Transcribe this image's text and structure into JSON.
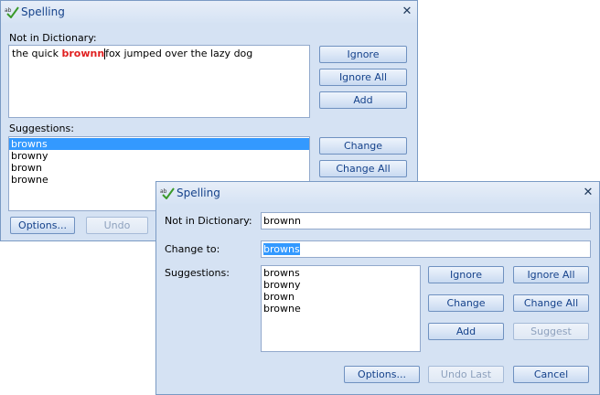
{
  "back_dialog": {
    "title": "Spelling",
    "close_symbol": "✕",
    "not_in_dict_label": "Not in Dictionary:",
    "sentence_before": "the quick ",
    "sentence_error": "brownn",
    "sentence_after": "fox jumped over the lazy dog",
    "suggestions_label": "Suggestions:",
    "suggestions": [
      "browns",
      "browny",
      "brown",
      "browne"
    ],
    "selected_suggestion": "browns",
    "buttons": {
      "ignore": "Ignore",
      "ignore_all": "Ignore All",
      "add": "Add",
      "change": "Change",
      "change_all": "Change All",
      "options": "Options...",
      "undo": "Undo"
    }
  },
  "front_dialog": {
    "title": "Spelling",
    "close_symbol": "✕",
    "not_in_dict_label": "Not in Dictionary:",
    "not_in_dict_value": "brownn",
    "change_to_label": "Change to:",
    "change_to_value": "browns",
    "suggestions_label": "Suggestions:",
    "suggestions": [
      "browns",
      "browny",
      "brown",
      "browne"
    ],
    "buttons": {
      "ignore": "Ignore",
      "ignore_all": "Ignore All",
      "change": "Change",
      "change_all": "Change All",
      "add": "Add",
      "suggest": "Suggest",
      "options": "Options...",
      "undo_last": "Undo Last",
      "cancel": "Cancel"
    }
  },
  "icons": {
    "title_icon": "spellcheck-abc-checkmark-icon",
    "close": "close-icon"
  },
  "colors": {
    "dialog_bg": "#d5e2f3",
    "title_text": "#15428b",
    "selection": "#3399ff",
    "error_text": "#e02020"
  }
}
